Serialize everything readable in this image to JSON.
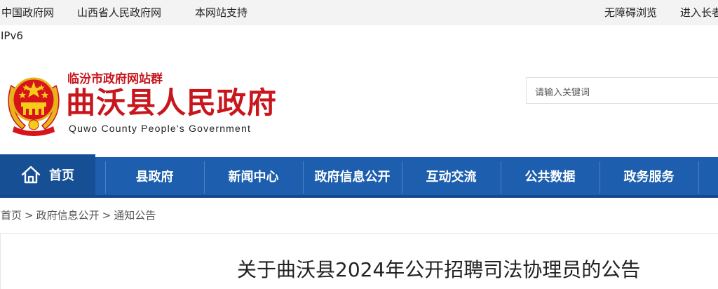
{
  "topbar": {
    "left_links": [
      "中国政府网",
      "山西省人民政府网",
      "本网站支持"
    ],
    "right_links": [
      "无障碍浏览",
      "进入长者"
    ]
  },
  "ipv6_label": "IPv6",
  "header": {
    "site_group": "临汾市政府网站群",
    "title": "曲沃县人民政府",
    "subtitle": "Quwo County People's Government",
    "emblem_icon": "national-emblem-icon"
  },
  "search": {
    "placeholder": "请输入关键词"
  },
  "nav": {
    "items": [
      "首页",
      "县政府",
      "新闻中心",
      "政府信息公开",
      "互动交流",
      "公共数据",
      "政务服务"
    ],
    "active_index": 0,
    "home_icon": "home-icon"
  },
  "breadcrumb": {
    "items": [
      "首页",
      "政府信息公开",
      "通知公告"
    ],
    "separator": ">"
  },
  "article": {
    "title": "关于曲沃县2024年公开招聘司法协理员的公告"
  },
  "colors": {
    "brand_red": "#c8161d",
    "nav_blue": "#1d5fae",
    "nav_active": "#174f95",
    "topbar_bg": "#f3f3f3"
  }
}
